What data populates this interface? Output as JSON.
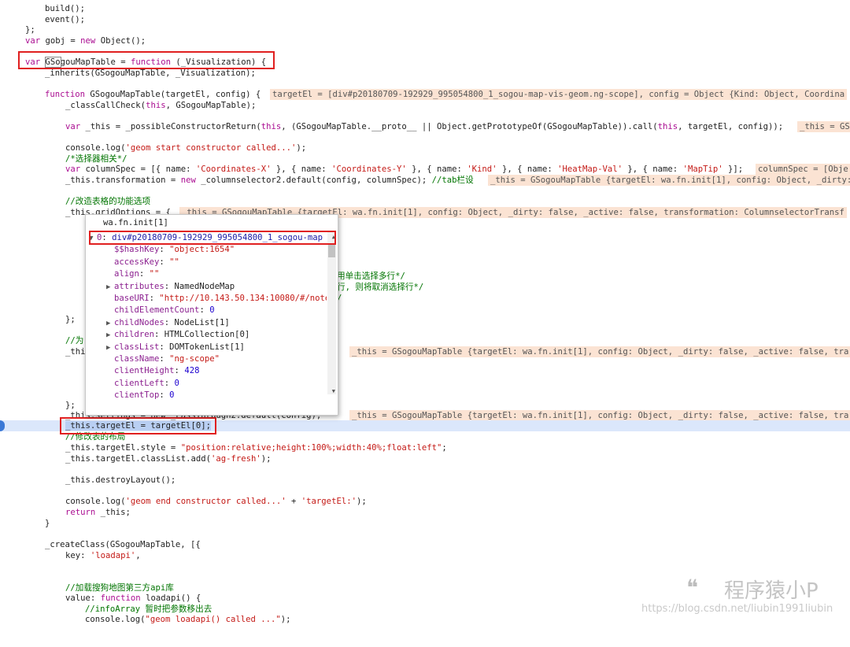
{
  "code": {
    "l1": "build();",
    "l2": "event();",
    "l3": "};",
    "l4_kw": "var",
    "l4_rest": " gobj = ",
    "l4_kw2": "new",
    "l4_rest2": " Object();",
    "l5_kw": "var",
    "l5_a": " ",
    "l5_word": "GSo",
    "l5_b": "gouMapTable = ",
    "l5_kw2": "function",
    "l5_c": " (_Visualization) {",
    "l6": "_inherits(GSogouMapTable, _Visualization);",
    "l7_kw": "function",
    "l7_rest": " GSogouMapTable(targetEl, config) {",
    "l7_hint": "targetEl = [div#p20180709-192929_995054800_1_sogou-map-vis-geom.ng-scope], config = Object {Kind: Object, Coordina",
    "l8_a": "_classCallCheck(",
    "l8_kw": "this",
    "l8_b": ", GSogouMapTable);",
    "l9_kw": "var",
    "l9_a": " _this = _possibleConstructorReturn(",
    "l9_kw2": "this",
    "l9_b": ", (GSogouMapTable.__proto__ || Object.getPrototypeOf(GSogouMapTable)).call(",
    "l9_kw3": "this",
    "l9_c": ", targetEl, config));",
    "l9_hint": "_this = GS",
    "l10_a": "console.log(",
    "l10_str": "'geom start constructor called...'",
    "l10_b": ");",
    "l11": "/*选择器相关*/",
    "l12_kw": "var",
    "l12_a": " columnSpec = [{ name: ",
    "l12_s1": "'Coordinates-X'",
    "l12_b": " }, { name: ",
    "l12_s2": "'Coordinates-Y'",
    "l12_c": " }, { name: ",
    "l12_s3": "'Kind'",
    "l12_d": " }, { name: ",
    "l12_s4": "'HeatMap-Val'",
    "l12_e": " }, { name: ",
    "l12_s5": "'MapTip'",
    "l12_f": " }];",
    "l12_hint": "columnSpec = [Obje",
    "l13_a": "_this.transformation = ",
    "l13_kw": "new",
    "l13_b": " _columnselector2.default(config, columnSpec); ",
    "l13_cmt": "//tab栏设",
    "l13_hint": "_this = GSogouMapTable {targetEl: wa.fn.init[1], config: Object, _dirty:",
    "l14": "//改造表格的功能选项",
    "l15_a": "_this.gridOptions = {",
    "l15_hint": "_this = GSogouMapTable {targetEl: wa.fn.init[1], config: Object, _dirty: false, _active: false, transformation: ColumnselectorTransf",
    "l16_cmt": "用单击选择多行*/",
    "l17_cmt": "行, 则将取消选择行*/",
    "l18_cmt": "/",
    "l19": "};",
    "l20": "//为",
    "l21_a": "_thi",
    "l21_hint": "_this = GSogouMapTable {targetEl: wa.fn.init[1], config: Object, _dirty: false, _active: false, tra",
    "l22": "};",
    "l23_a": "_this.settings = new _PassThrough2.default(config);",
    "l23_hint": "_this = GSogouMapTable {targetEl: wa.fn.init[1], config: Object, _dirty: false, _active: false, tra",
    "l24_a": "_this.targetEl",
    "l24_b": " = targetEl[0];",
    "l25": "//修改表的布局",
    "l26_a": "_this.targetEl.style = ",
    "l26_str": "\"position:relative;height:100%;width:40%;float:left\"",
    "l26_b": ";",
    "l27_a": "_this.targetEl.classList.add(",
    "l27_str": "'ag-fresh'",
    "l27_b": ");",
    "l28": "_this.destroyLayout();",
    "l29_a": "console.log(",
    "l29_str": "'geom end constructor called...'",
    "l29_b": " + ",
    "l29_str2": "'targetEl:'",
    "l29_c": ");",
    "l30_kw": "return",
    "l30_rest": " _this;",
    "l31": "}",
    "l32": "_createClass(GSogouMapTable, [{",
    "l33_a": "key: ",
    "l33_str": "'loadapi'",
    "l33_b": ",",
    "l34": "//加载搜狗地图第三方api库",
    "l35_a": "value: ",
    "l35_kw": "function",
    "l35_b": " loadapi() {",
    "l36_cmt": "//infoArray 暂时把参数移出去",
    "l37_a": "console.log(",
    "l37_str": "\"geom loadapi() called ...\"",
    "l37_b": ");"
  },
  "popover": {
    "title": "wa.fn.init[1]",
    "rows": [
      {
        "tri": "▼",
        "key": "0",
        "val": "div#p20180709-192929_995054800_1_sogou-map",
        "vtype": "obj"
      },
      {
        "tri": "",
        "key": "$$hashKey",
        "val": "\"object:1654\"",
        "vtype": "str"
      },
      {
        "tri": "",
        "key": "accessKey",
        "val": "\"\"",
        "vtype": "str"
      },
      {
        "tri": "",
        "key": "align",
        "val": "\"\"",
        "vtype": "str"
      },
      {
        "tri": "▶",
        "key": "attributes",
        "val": "NamedNodeMap",
        "vtype": "obj"
      },
      {
        "tri": "",
        "key": "baseURI",
        "val": "\"http://10.143.50.134:10080/#/note",
        "vtype": "str"
      },
      {
        "tri": "",
        "key": "childElementCount",
        "val": "0",
        "vtype": "num"
      },
      {
        "tri": "▶",
        "key": "childNodes",
        "val": "NodeList[1]",
        "vtype": "obj"
      },
      {
        "tri": "▶",
        "key": "children",
        "val": "HTMLCollection[0]",
        "vtype": "obj"
      },
      {
        "tri": "▶",
        "key": "classList",
        "val": "DOMTokenList[1]",
        "vtype": "obj"
      },
      {
        "tri": "",
        "key": "className",
        "val": "\"ng-scope\"",
        "vtype": "str"
      },
      {
        "tri": "",
        "key": "clientHeight",
        "val": "428",
        "vtype": "num"
      },
      {
        "tri": "",
        "key": "clientLeft",
        "val": "0",
        "vtype": "num"
      },
      {
        "tri": "",
        "key": "clientTop",
        "val": "0",
        "vtype": "num"
      }
    ]
  },
  "watermark": {
    "logo": "❝",
    "name": "程序猿小P",
    "url": "https://blog.csdn.net/liubin1991liubin"
  }
}
